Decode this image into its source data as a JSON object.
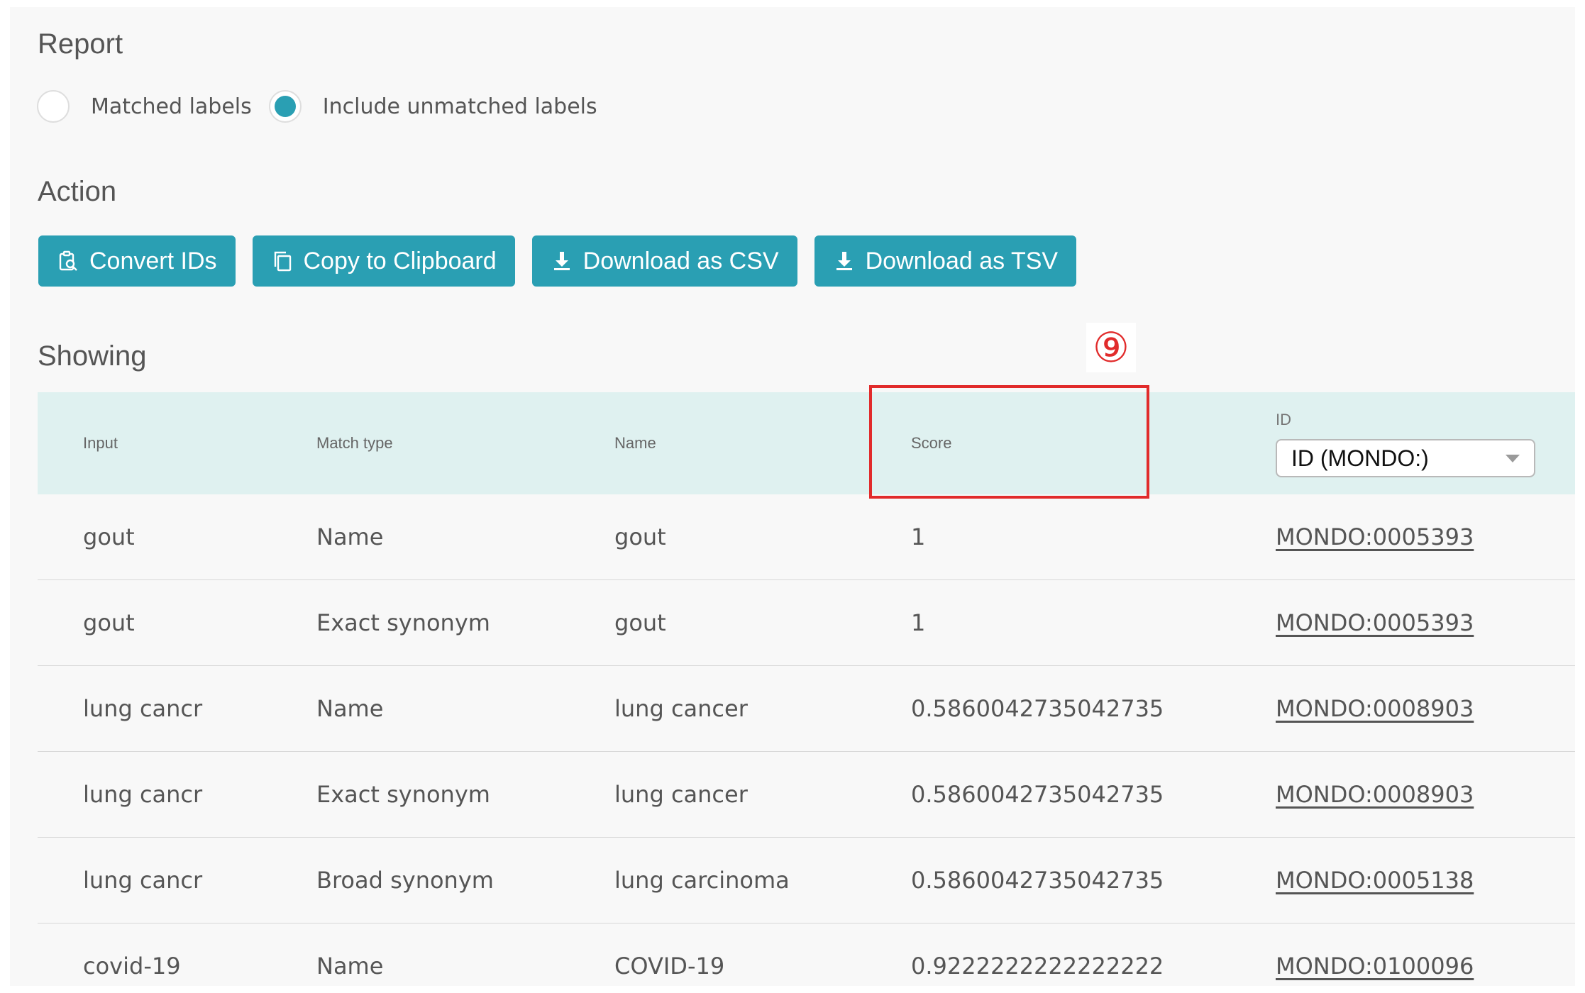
{
  "report": {
    "title": "Report",
    "options": [
      {
        "label": "Matched labels",
        "checked": false
      },
      {
        "label": "Include unmatched labels",
        "checked": true
      }
    ]
  },
  "action": {
    "title": "Action",
    "buttons": [
      {
        "label": "Convert IDs",
        "icon": "clipboard-search-icon"
      },
      {
        "label": "Copy to Clipboard",
        "icon": "copy-icon"
      },
      {
        "label": "Download as CSV",
        "icon": "download-icon"
      },
      {
        "label": "Download as TSV",
        "icon": "download-icon"
      }
    ]
  },
  "showing": {
    "title": "Showing"
  },
  "table": {
    "headers": {
      "input": "Input",
      "match_type": "Match type",
      "name": "Name",
      "score": "Score",
      "id": "ID"
    },
    "id_select_value": "ID (MONDO:)",
    "rows": [
      {
        "input": "gout",
        "match_type": "Name",
        "name": "gout",
        "score": "1",
        "id": "MONDO:0005393"
      },
      {
        "input": "gout",
        "match_type": "Exact synonym",
        "name": "gout",
        "score": "1",
        "id": "MONDO:0005393"
      },
      {
        "input": "lung cancr",
        "match_type": "Name",
        "name": "lung cancer",
        "score": "0.5860042735042735",
        "id": "MONDO:0008903"
      },
      {
        "input": "lung cancr",
        "match_type": "Exact synonym",
        "name": "lung cancer",
        "score": "0.5860042735042735",
        "id": "MONDO:0008903"
      },
      {
        "input": "lung cancr",
        "match_type": "Broad synonym",
        "name": "lung carcinoma",
        "score": "0.5860042735042735",
        "id": "MONDO:0005138"
      },
      {
        "input": "covid-19",
        "match_type": "Name",
        "name": "COVID-19",
        "score": "0.9222222222222222",
        "id": "MONDO:0100096"
      }
    ]
  },
  "annotation": {
    "marker": "⑨"
  },
  "colors": {
    "accent": "#2a9fb3",
    "table_header_bg": "#dff1f0",
    "annotation": "#e12b2b",
    "panel_bg": "#f8f8f8"
  }
}
